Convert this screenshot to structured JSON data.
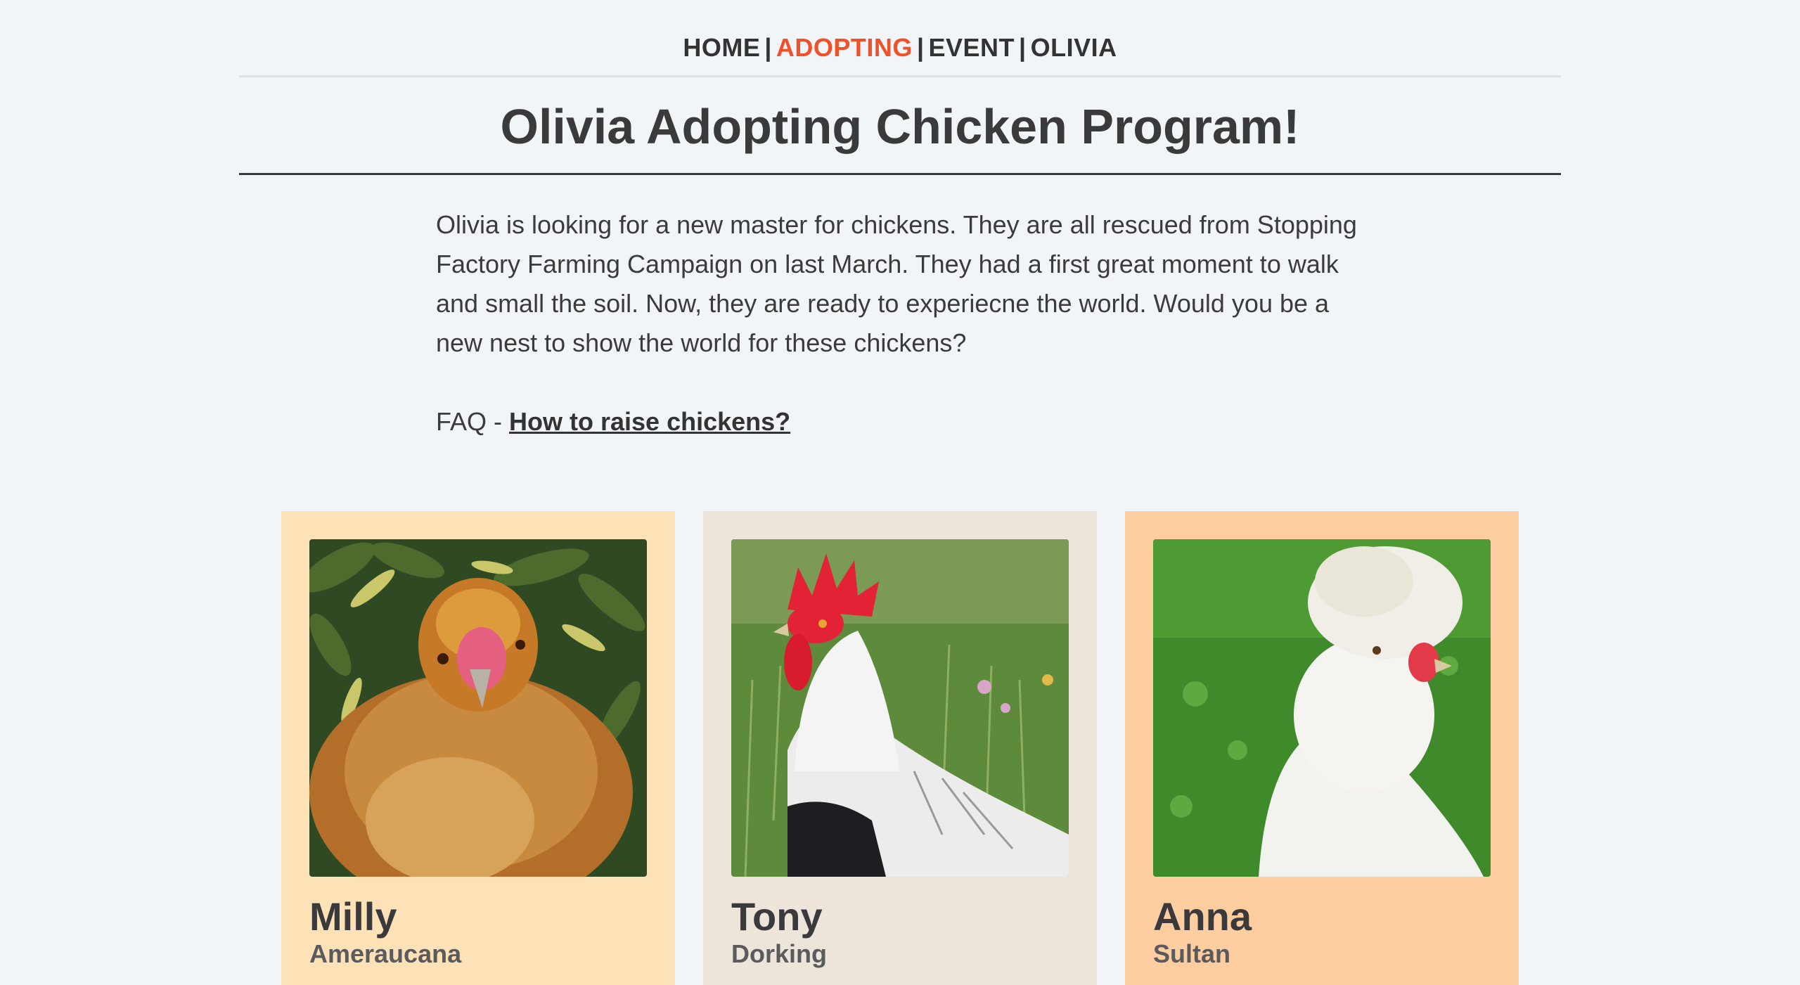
{
  "nav": {
    "items": [
      {
        "label": "HOME",
        "active": false
      },
      {
        "label": "ADOPTING",
        "active": true
      },
      {
        "label": "EVENT",
        "active": false
      },
      {
        "label": "OLIVIA",
        "active": false
      }
    ],
    "separator": "|",
    "active_color": "#f0512a"
  },
  "page": {
    "title": "Olivia Adopting Chicken Program!",
    "intro": "Olivia is looking for a new master for chickens. They are all rescued from Stopping Factory Farming Campaign on last March. They had a first great moment to walk and small the soil. Now, they are ready to experiecne the world. Would you be a new nest to show the world for these chickens?",
    "faq_prefix": "FAQ - ",
    "faq_link": "How to raise chickens?"
  },
  "cards": [
    {
      "name": "Milly",
      "breed": "Ameraucana",
      "bg": "#fde2b8"
    },
    {
      "name": "Tony",
      "breed": "Dorking",
      "bg": "#ede5da"
    },
    {
      "name": "Anna",
      "breed": "Sultan",
      "bg": "#fecea0"
    }
  ],
  "colors": {
    "background": "#f2f5f8",
    "text": "#3b3b3d"
  }
}
